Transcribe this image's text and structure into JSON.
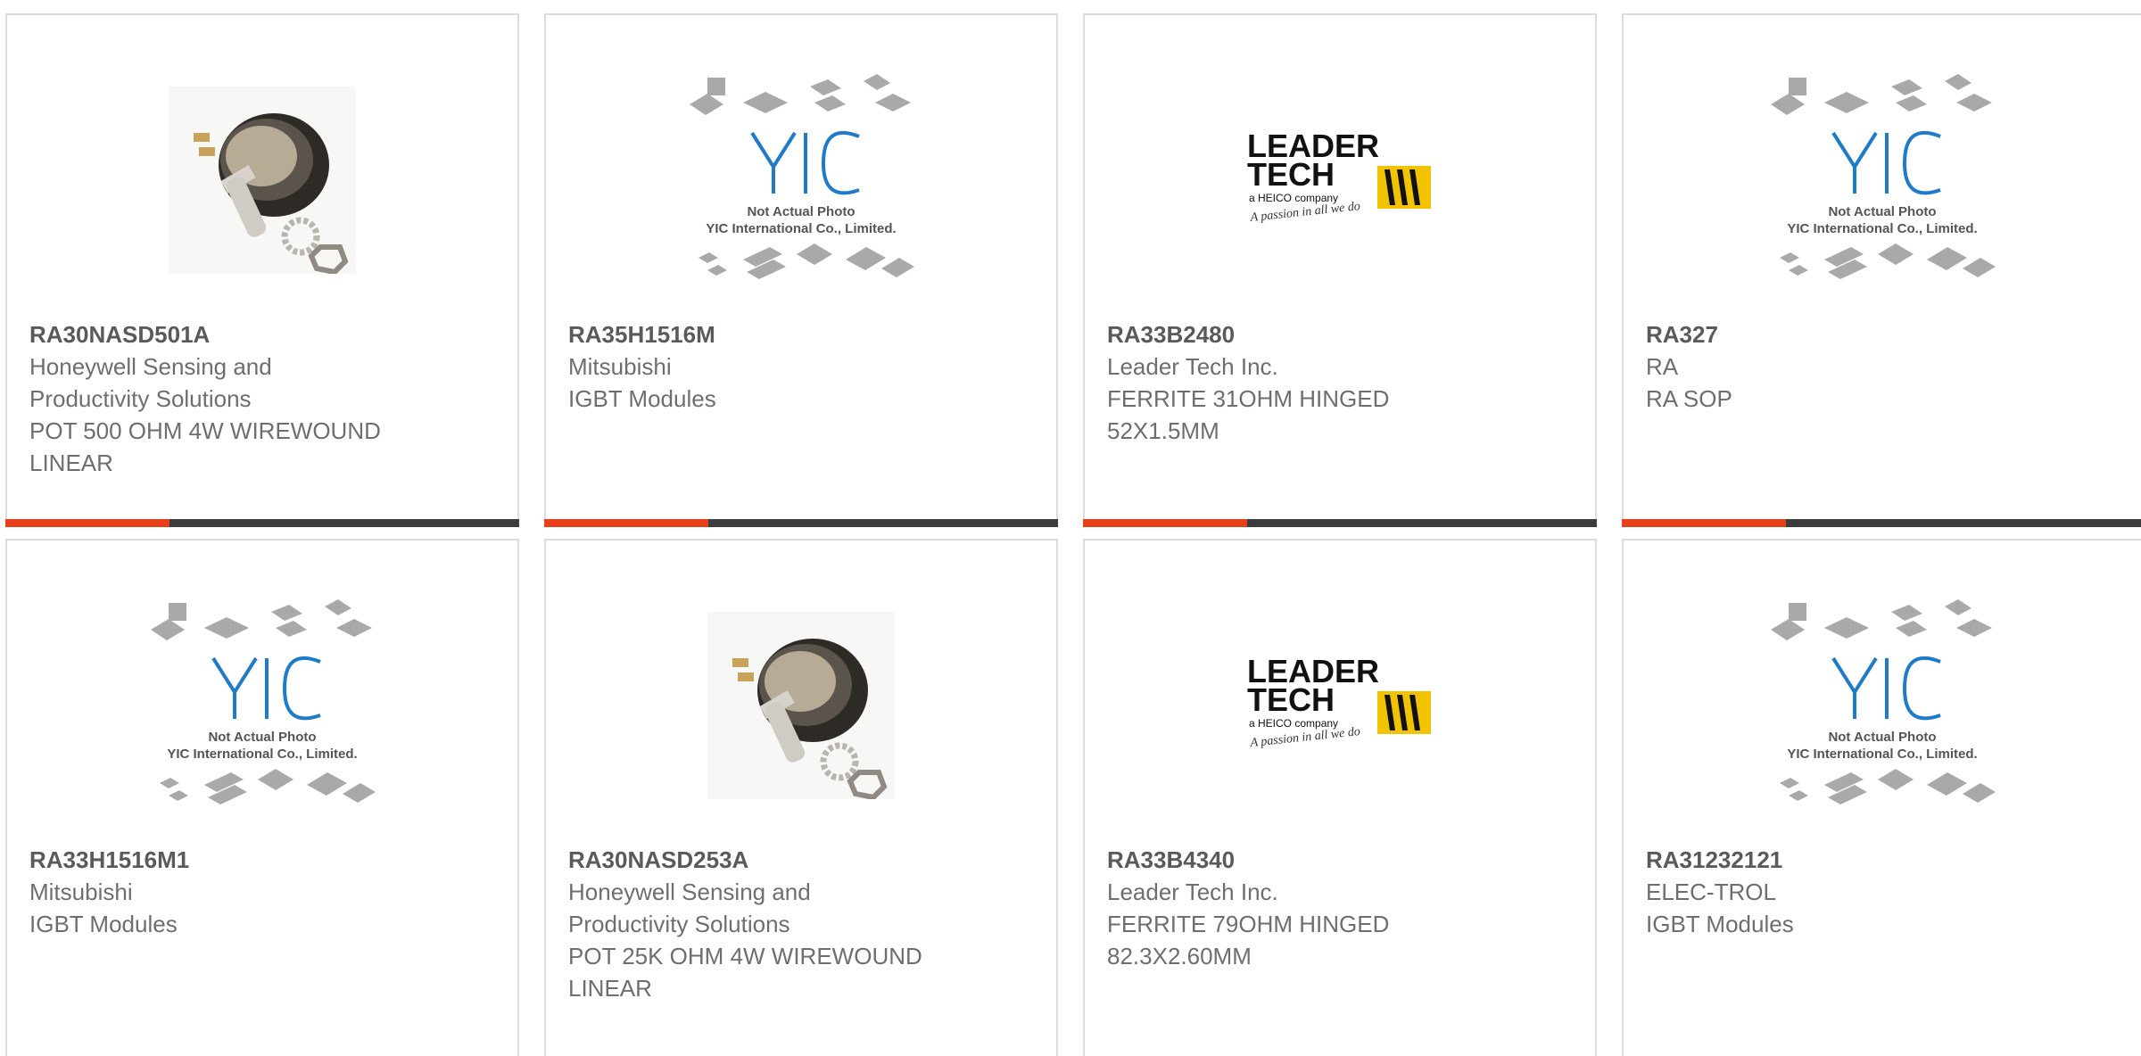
{
  "products": [
    {
      "part_number": "RA30NASD501A",
      "manufacturer": "Honeywell Sensing and Productivity Solutions",
      "description": "POT 500 OHM 4W WIREWOUND LINEAR",
      "image": "potentiometer-image"
    },
    {
      "part_number": "RA35H1516M",
      "manufacturer": "Mitsubishi",
      "description": "IGBT Modules",
      "image": "yic-placeholder-image"
    },
    {
      "part_number": "RA33B2480",
      "manufacturer": "Leader Tech Inc.",
      "description": "FERRITE 31OHM HINGED 52X1.5MM",
      "image": "leader-tech-logo"
    },
    {
      "part_number": "RA327",
      "manufacturer": "RA",
      "description": "RA SOP",
      "image": "yic-placeholder-image"
    },
    {
      "part_number": "RA33H1516M1",
      "manufacturer": "Mitsubishi",
      "description": "IGBT Modules",
      "image": "yic-placeholder-image"
    },
    {
      "part_number": "RA30NASD253A",
      "manufacturer": "Honeywell Sensing and Productivity Solutions",
      "description": "POT 25K OHM 4W WIREWOUND LINEAR",
      "image": "potentiometer-image"
    },
    {
      "part_number": "RA33B4340",
      "manufacturer": "Leader Tech Inc.",
      "description": "FERRITE 79OHM HINGED 82.3X2.60MM",
      "image": "leader-tech-logo"
    },
    {
      "part_number": "RA31232121",
      "manufacturer": "ELEC-TROL",
      "description": "IGBT Modules",
      "image": "yic-placeholder-image"
    }
  ],
  "placeholder": {
    "logo_text": "YIC",
    "caption_line1": "Not Actual Photo",
    "caption_line2": "YIC International Co., Limited."
  },
  "leader_tech_logo": {
    "line1": "LEADER",
    "line2": "TECH",
    "tagline": "a HEICO company",
    "slogan": "A passion in all we do"
  },
  "colors": {
    "accent": "#e8401b",
    "bar_dark": "#3c3c3c",
    "card_border": "#dcdcdc",
    "yic_blue": "#1f7ac9",
    "leader_yellow": "#f2c300"
  }
}
